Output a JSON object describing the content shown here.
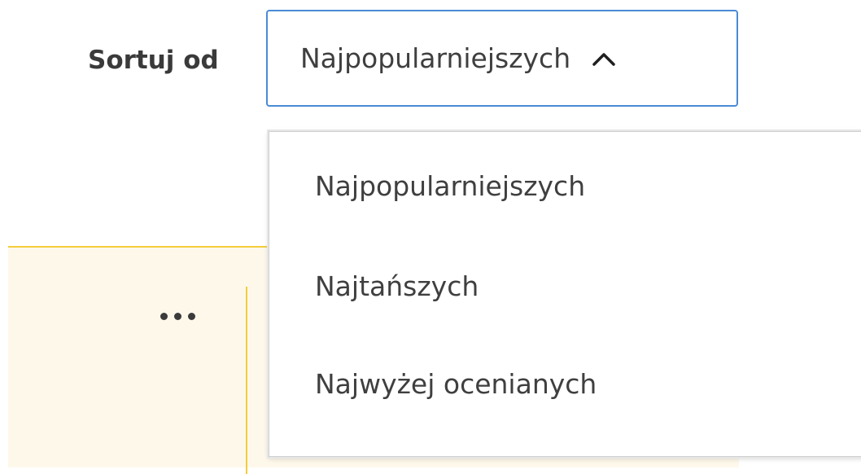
{
  "sort": {
    "label": "Sortuj od",
    "selected": "Najpopularniejszych",
    "options": [
      "Najpopularniejszych",
      "Najtańszych",
      "Najwyżej ocenianych"
    ],
    "expanded": true
  },
  "colors": {
    "select_border": "#4a8bd6",
    "card_background": "#fdf8ea",
    "card_accent": "#f3cd3a",
    "text": "#3f3f3f"
  },
  "icons": {
    "select_toggle": "chevron-up-icon",
    "card_menu": "more-horizontal-icon"
  }
}
